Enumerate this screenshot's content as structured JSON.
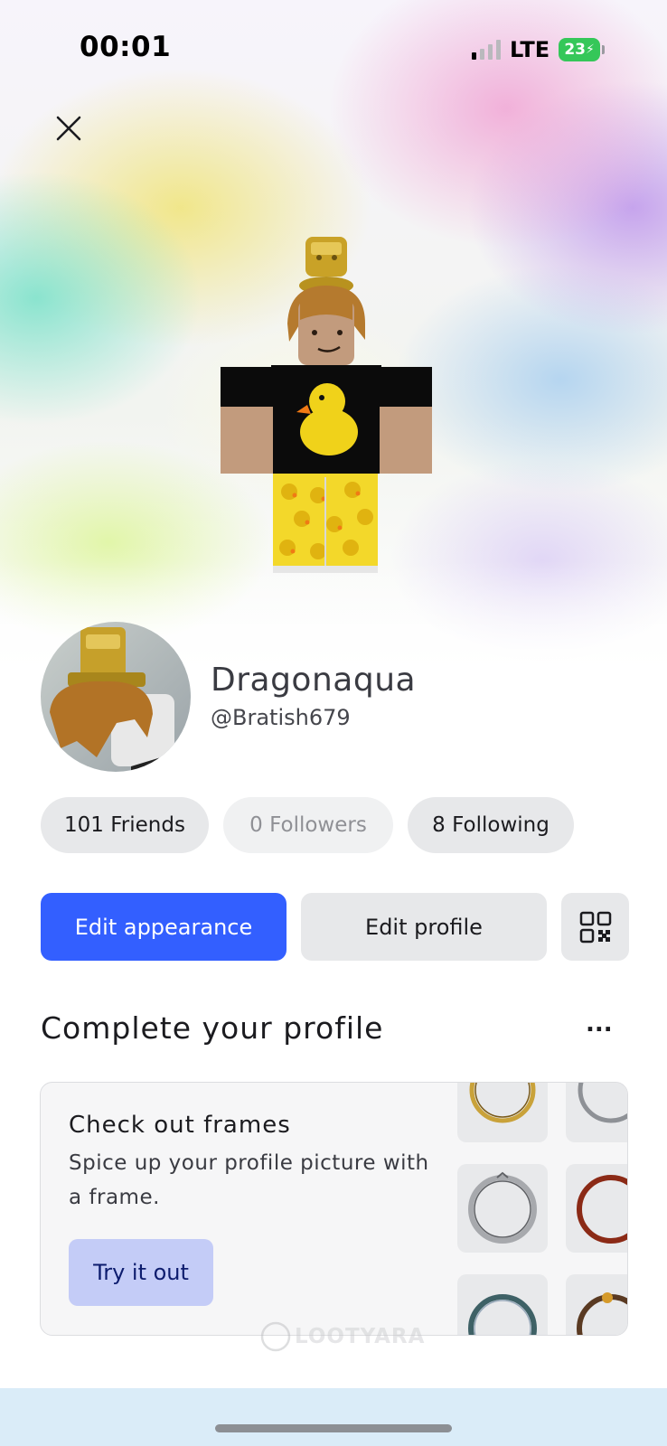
{
  "status_bar": {
    "time": "00:01",
    "network": "LTE",
    "battery": "23",
    "signal_bars_active": 1,
    "signal_bars_total": 4
  },
  "header": {
    "close_icon": "close-icon"
  },
  "profile": {
    "display_name": "Dragonaqua",
    "username": "@Bratish679"
  },
  "stats": {
    "friends": "101 Friends",
    "followers": "0 Followers",
    "following": "8 Following"
  },
  "actions": {
    "edit_appearance": "Edit appearance",
    "edit_profile": "Edit profile",
    "qr_icon": "qr-code-icon"
  },
  "complete_profile": {
    "title": "Complete your profile",
    "more_label": "...",
    "card": {
      "title": "Check out frames",
      "description": "Spice up your profile picture with a frame.",
      "button": "Try it out"
    }
  },
  "watermark": "LOOTYARA",
  "colors": {
    "primary_button": "#335fff",
    "secondary_button": "#e7e8ea",
    "try_button": "#c4ccf7",
    "battery": "#35c759",
    "bottom_bar": "#daecf8"
  }
}
